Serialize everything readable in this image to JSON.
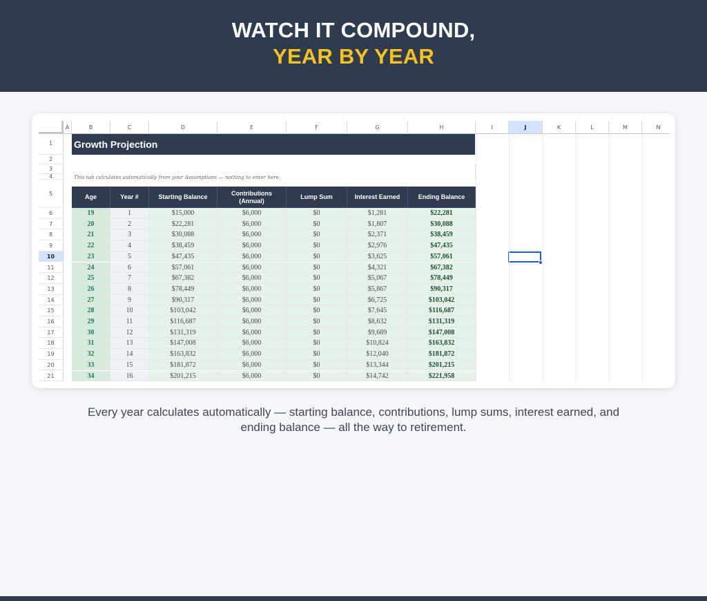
{
  "banner": {
    "line1": "WATCH IT COMPOUND,",
    "line2": "YEAR BY YEAR"
  },
  "colors": {
    "banner_bg": "#2f3b4f",
    "accent_yellow": "#f3c41d",
    "table_green": "#e4f2e7",
    "age_green": "#1e7a5c",
    "selection_blue": "#1a5fd0"
  },
  "sheet": {
    "columns": [
      "A",
      "B",
      "C",
      "D",
      "E",
      "F",
      "G",
      "H",
      "I",
      "J",
      "K",
      "L",
      "M",
      "N"
    ],
    "selected_column": "J",
    "rows": [
      "1",
      "2",
      "3",
      "4",
      "5",
      "6",
      "7",
      "8",
      "9",
      "10",
      "11",
      "12",
      "13",
      "14",
      "15",
      "16",
      "17",
      "18",
      "19",
      "20",
      "21"
    ],
    "selected_row": "10",
    "title": "Growth Projection",
    "note": "This tab calculates automatically from your Assumptions — nothing to enter here.",
    "headers": [
      "Age",
      "Year #",
      "Starting Balance",
      "Contributions (Annual)",
      "Lump Sum",
      "Interest Earned",
      "Ending Balance"
    ],
    "data_rows": [
      [
        "19",
        "1",
        "$15,000",
        "$6,000",
        "$0",
        "$1,281",
        "$22,281"
      ],
      [
        "20",
        "2",
        "$22,281",
        "$6,000",
        "$0",
        "$1,807",
        "$30,088"
      ],
      [
        "21",
        "3",
        "$30,088",
        "$6,000",
        "$0",
        "$2,371",
        "$38,459"
      ],
      [
        "22",
        "4",
        "$38,459",
        "$6,000",
        "$0",
        "$2,976",
        "$47,435"
      ],
      [
        "23",
        "5",
        "$47,435",
        "$6,000",
        "$0",
        "$3,625",
        "$57,061"
      ],
      [
        "24",
        "6",
        "$57,061",
        "$6,000",
        "$0",
        "$4,321",
        "$67,382"
      ],
      [
        "25",
        "7",
        "$67,382",
        "$6,000",
        "$0",
        "$5,067",
        "$78,449"
      ],
      [
        "26",
        "8",
        "$78,449",
        "$6,000",
        "$0",
        "$5,867",
        "$90,317"
      ],
      [
        "27",
        "9",
        "$90,317",
        "$6,000",
        "$0",
        "$6,725",
        "$103,042"
      ],
      [
        "28",
        "10",
        "$103,042",
        "$6,000",
        "$0",
        "$7,645",
        "$116,687"
      ],
      [
        "29",
        "11",
        "$116,687",
        "$6,000",
        "$0",
        "$8,632",
        "$131,319"
      ],
      [
        "30",
        "12",
        "$131,319",
        "$6,000",
        "$0",
        "$9,689",
        "$147,008"
      ],
      [
        "31",
        "13",
        "$147,008",
        "$6,000",
        "$0",
        "$10,824",
        "$163,832"
      ],
      [
        "32",
        "14",
        "$163,832",
        "$6,000",
        "$0",
        "$12,040",
        "$181,872"
      ],
      [
        "33",
        "15",
        "$181,872",
        "$6,000",
        "$0",
        "$13,344",
        "$201,215"
      ],
      [
        "34",
        "16",
        "$201,215",
        "$6,000",
        "$0",
        "$14,742",
        "$221,958"
      ]
    ]
  },
  "caption": "Every year calculates automatically — starting balance, contributions, lump sums, interest earned, and ending balance — all the way to retirement."
}
